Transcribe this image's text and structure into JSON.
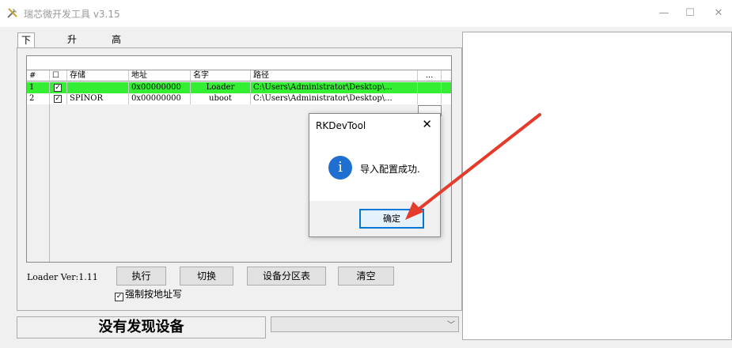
{
  "window": {
    "title": "瑞芯微开发工具 v3.15",
    "minimize_glyph": "—",
    "maximize_glyph": "☐",
    "close_glyph": "✕"
  },
  "tabs": [
    {
      "label": "下载镜像",
      "active": true
    },
    {
      "label": "升级固件",
      "active": false
    },
    {
      "label": "高级功能",
      "active": false
    }
  ],
  "table": {
    "headers": [
      "#",
      "☐",
      "存储",
      "地址",
      "名字",
      "路径",
      "..."
    ],
    "rows": [
      {
        "index": "1",
        "checked": "✓",
        "storage": "",
        "address": "0x00000000",
        "name": "Loader",
        "path": "C:\\Users\\Administrator\\Desktop\\...",
        "highlight": true
      },
      {
        "index": "2",
        "checked": "✓",
        "storage": "SPINOR",
        "address": "0x00000000",
        "name": "uboot",
        "path": "C:\\Users\\Administrator\\Desktop\\...",
        "highlight": false
      }
    ],
    "highlight_color": "#33ee33"
  },
  "loader_version": "Loader Ver:1.11",
  "buttons": {
    "run": "执行",
    "switch": "切换",
    "partition": "设备分区表",
    "clear": "清空"
  },
  "force_address_write": {
    "label": "强制按地址写",
    "checked": true
  },
  "status_text": "没有发现设备",
  "combo_arrow": "﹀",
  "dialog": {
    "title": "RKDevTool",
    "close_glyph": "✕",
    "icon": "info-icon",
    "icon_glyph": "i",
    "message": "导入配置成功.",
    "ok_label": "确定"
  },
  "colors": {
    "dialog_accent": "#0078d7",
    "info_icon": "#1f6fd1",
    "annotation_arrow": "#e53b2c"
  }
}
